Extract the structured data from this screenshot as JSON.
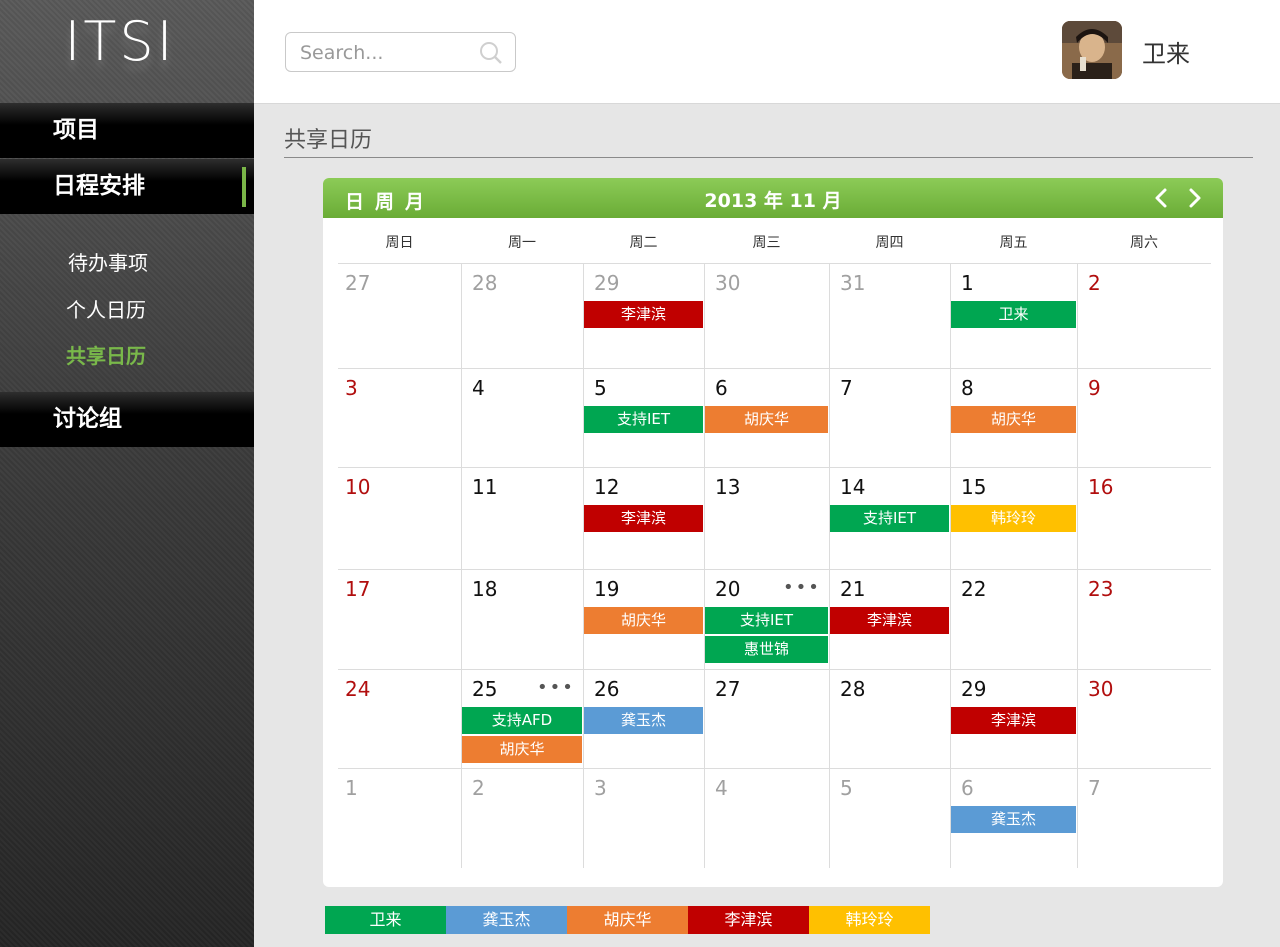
{
  "app": {
    "logo": "ITSI"
  },
  "sidebar": {
    "main_items": [
      {
        "label": "项目"
      },
      {
        "label": "日程安排",
        "active": true
      },
      {
        "label": "讨论组"
      }
    ],
    "sub_items": [
      {
        "label": "待办事项"
      },
      {
        "label": "个人日历"
      },
      {
        "label": "共享日历",
        "active": true
      }
    ],
    "accent_color": "#79b84a"
  },
  "header": {
    "search": {
      "placeholder": "Search..."
    },
    "user": {
      "name": "卫来"
    }
  },
  "page": {
    "title": "共享日历"
  },
  "calendar": {
    "view_tabs": [
      "日",
      "周",
      "月"
    ],
    "month_label": "2013 年 11 月",
    "weekdays": [
      "周日",
      "周一",
      "周二",
      "周三",
      "周四",
      "周五",
      "周六"
    ],
    "weeks": [
      [
        "27",
        "28",
        "29",
        "30",
        "31",
        "1",
        "2"
      ],
      [
        "3",
        "4",
        "5",
        "6",
        "7",
        "8",
        "9"
      ],
      [
        "10",
        "11",
        "12",
        "13",
        "14",
        "15",
        "16"
      ],
      [
        "17",
        "18",
        "19",
        "20",
        "21",
        "22",
        "23"
      ],
      [
        "24",
        "25",
        "26",
        "27",
        "28",
        "29",
        "30"
      ],
      [
        "1",
        "2",
        "3",
        "4",
        "5",
        "6",
        "7"
      ]
    ],
    "more_indicator": "•••",
    "events": [
      {
        "week": 0,
        "day": 2,
        "slot": 0,
        "person": "李津滨"
      },
      {
        "week": 0,
        "day": 5,
        "slot": 0,
        "person": "卫来"
      },
      {
        "week": 1,
        "day": 2,
        "slot": 0,
        "person": "支持IET",
        "color_of": "卫来"
      },
      {
        "week": 1,
        "day": 3,
        "slot": 0,
        "person": "胡庆华"
      },
      {
        "week": 1,
        "day": 5,
        "slot": 0,
        "person": "胡庆华"
      },
      {
        "week": 2,
        "day": 2,
        "slot": 0,
        "person": "李津滨"
      },
      {
        "week": 2,
        "day": 4,
        "slot": 0,
        "person": "支持IET",
        "color_of": "卫来"
      },
      {
        "week": 2,
        "day": 5,
        "slot": 0,
        "person": "韩玲玲"
      },
      {
        "week": 3,
        "day": 2,
        "slot": 0,
        "person": "胡庆华"
      },
      {
        "week": 3,
        "day": 3,
        "slot": 0,
        "person": "支持IET",
        "color_of": "卫来"
      },
      {
        "week": 3,
        "day": 3,
        "slot": 1,
        "person": "惠世锦",
        "color_of": "卫来"
      },
      {
        "week": 3,
        "day": 4,
        "slot": 0,
        "person": "李津滨"
      },
      {
        "week": 4,
        "day": 1,
        "slot": 0,
        "person": "支持AFD",
        "color_of": "卫来"
      },
      {
        "week": 4,
        "day": 1,
        "slot": 1,
        "person": "胡庆华"
      },
      {
        "week": 4,
        "day": 2,
        "slot": 0,
        "person": "龚玉杰"
      },
      {
        "week": 4,
        "day": 5,
        "slot": 0,
        "person": "李津滨"
      },
      {
        "week": 5,
        "day": 5,
        "slot": 0,
        "person": "龚玉杰"
      }
    ],
    "more_cells": [
      {
        "week": 3,
        "day": 3
      },
      {
        "week": 4,
        "day": 1
      }
    ]
  },
  "legend": [
    {
      "name": "卫来",
      "color": "#00a651"
    },
    {
      "name": "龚玉杰",
      "color": "#5b9bd5"
    },
    {
      "name": "胡庆华",
      "color": "#ed7d31"
    },
    {
      "name": "李津滨",
      "color": "#c00000"
    },
    {
      "name": "韩玲玲",
      "color": "#ffc000"
    }
  ]
}
